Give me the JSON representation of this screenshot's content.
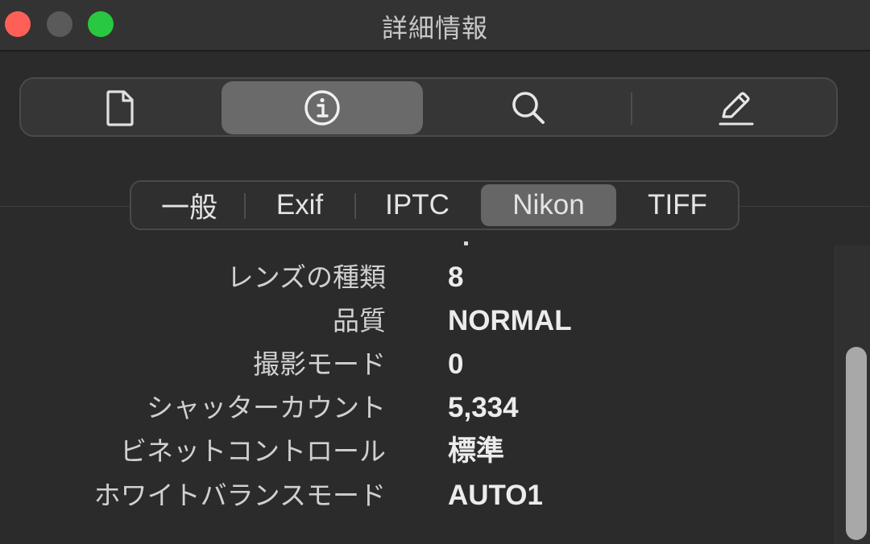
{
  "window": {
    "title": "詳細情報"
  },
  "toolbar": {
    "buttons": [
      {
        "icon": "document-icon"
      },
      {
        "icon": "info-icon",
        "active": true
      },
      {
        "icon": "search-icon"
      },
      {
        "icon": "pencil-icon"
      }
    ]
  },
  "subtabs": [
    {
      "label": "一般"
    },
    {
      "label": "Exif"
    },
    {
      "label": "IPTC"
    },
    {
      "label": "Nikon",
      "active": true
    },
    {
      "label": "TIFF"
    }
  ],
  "rows": [
    {
      "label": "レンズの種類",
      "value": "8"
    },
    {
      "label": "品質",
      "value": "NORMAL"
    },
    {
      "label": "撮影モード",
      "value": "0"
    },
    {
      "label": "シャッターカウント",
      "value": "5,334"
    },
    {
      "label": "ビネットコントロール",
      "value": "標準"
    },
    {
      "label": "ホワイトバランスモード",
      "value": "AUTO1"
    }
  ],
  "colors": {
    "background": "#2b2b2b",
    "titlebar": "#333333",
    "active_segment": "#6a6a6a",
    "close": "#fe5f57",
    "minimize": "#5a5a5a",
    "zoom": "#28c840"
  }
}
